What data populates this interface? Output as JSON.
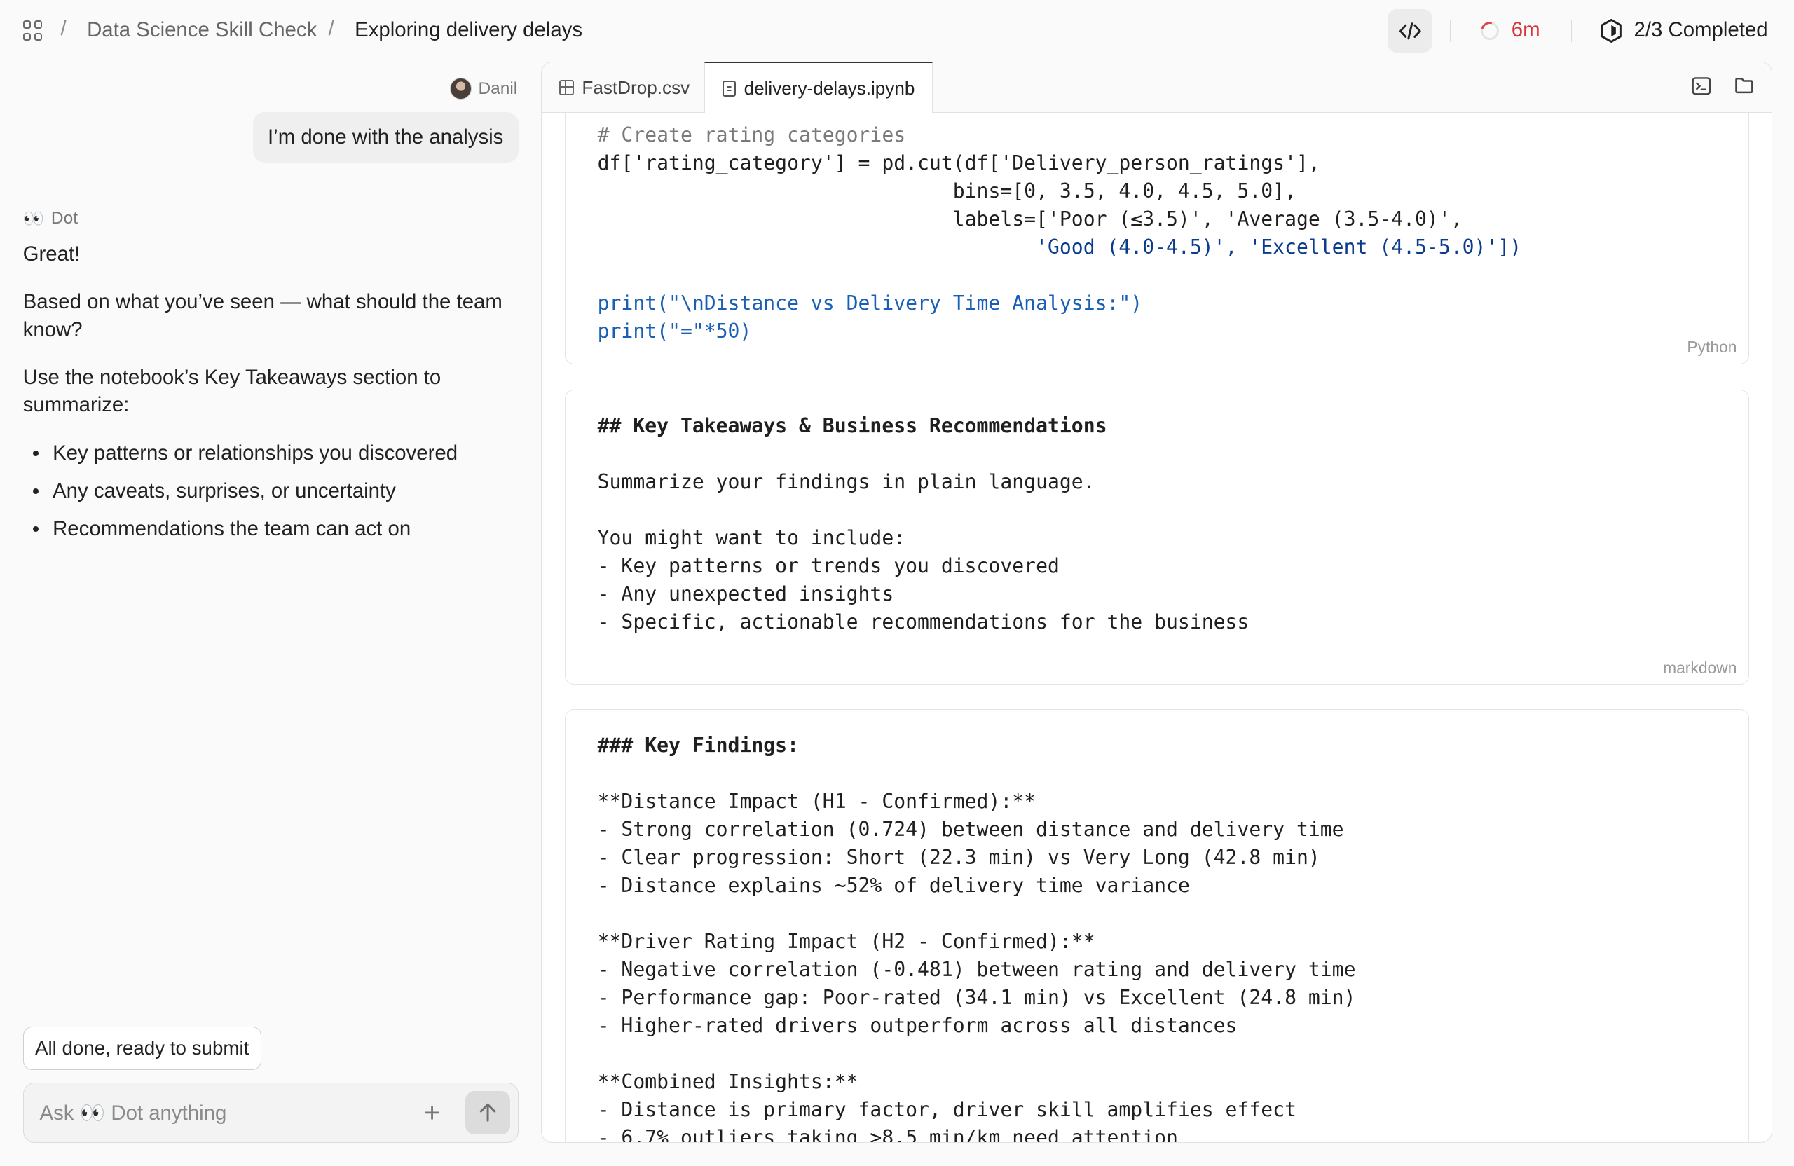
{
  "header": {
    "breadcrumb_1": "Data Science Skill Check",
    "breadcrumb_2": "Exploring delivery delays",
    "timer": "6m",
    "progress": "2/3 Completed"
  },
  "chat": {
    "user_name": "Danil",
    "user_message": "I’m done with the analysis",
    "assistant_name": "Dot",
    "assistant_msg_1": "Great!",
    "assistant_msg_2": "Based on what you’ve seen — what should the team know?",
    "assistant_msg_3": "Use the notebook’s Key Takeaways section to summarize:",
    "bullets": [
      "Key patterns or relationships you discovered",
      "Any caveats, surprises, or uncertainty",
      "Recommendations the team can act on"
    ],
    "suggestion": "All done, ready to submit",
    "input_placeholder": "Ask 👀 Dot anything"
  },
  "editor": {
    "tabs": [
      {
        "label": "FastDrop.csv"
      },
      {
        "label": "delivery-delays.ipynb"
      }
    ],
    "cell1_lang": "Python",
    "cell2_lang": "markdown",
    "cell1_lines": [
      "# Create rating categories",
      "df['rating_category'] = pd.cut(df['Delivery_person_ratings'],",
      "                              bins=[0, 3.5, 4.0, 4.5, 5.0],",
      "                              labels=['Poor (≤3.5)', 'Average (3.5-4.0)',",
      "                                     'Good (4.0-4.5)', 'Excellent (4.5-5.0)'])",
      "",
      "print(\"\\nDistance vs Delivery Time Analysis:\")",
      "print(\"=\"*50)"
    ],
    "cell2_lines": [
      "## Key Takeaways & Business Recommendations",
      "",
      "Summarize your findings in plain language.",
      "",
      "You might want to include:",
      "- Key patterns or trends you discovered",
      "- Any unexpected insights",
      "- Specific, actionable recommendations for the business"
    ],
    "cell3_lines": [
      "### Key Findings:",
      "",
      "**Distance Impact (H1 - Confirmed):**",
      "- Strong correlation (0.724) between distance and delivery time",
      "- Clear progression: Short (22.3 min) vs Very Long (42.8 min)",
      "- Distance explains ~52% of delivery time variance",
      "",
      "**Driver Rating Impact (H2 - Confirmed):**",
      "- Negative correlation (-0.481) between rating and delivery time",
      "- Performance gap: Poor-rated (34.1 min) vs Excellent (24.8 min)",
      "- Higher-rated drivers outperform across all distances",
      "",
      "**Combined Insights:**",
      "- Distance is primary factor, driver skill amplifies effect",
      "- 6.7% outliers taking >8.5 min/km need attention"
    ]
  }
}
